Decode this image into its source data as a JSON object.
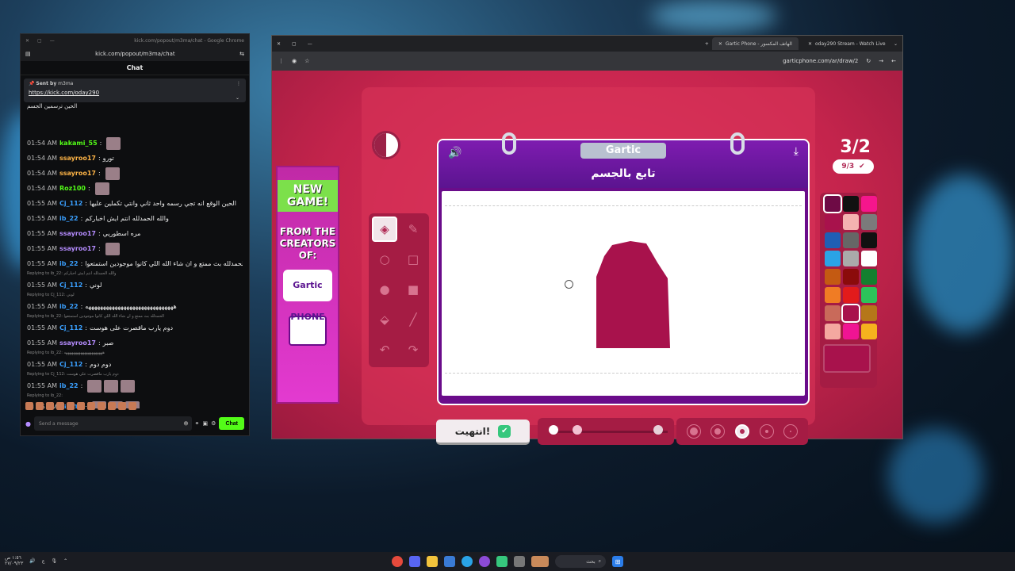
{
  "chat_window": {
    "title_url": "kick.com/popout/m3ma/chat - Google Chrome",
    "address": "kick.com/popout/m3ma/chat",
    "header": "Chat",
    "pinned": {
      "label": "Sent by",
      "user": "m3ma",
      "link": "https://kick.com/oday290"
    },
    "partial_top": "الحين ترسمين الجسم",
    "messages": [
      {
        "time": "01:54 AM",
        "user": "kakami_55",
        "color": "#53fc18",
        "text": "",
        "thumb": true
      },
      {
        "time": "01:54 AM",
        "user": "ssayroo17",
        "color": "#ffb547",
        "text": "تورو",
        "thumb": false
      },
      {
        "time": "01:54 AM",
        "user": "ssayroo17",
        "color": "#ffb547",
        "text": "",
        "thumb": true
      },
      {
        "time": "01:54 AM",
        "user": "Roz100",
        "color": "#53fc18",
        "text": "",
        "thumb": true
      },
      {
        "time": "01:55 AM",
        "user": "Cj_112",
        "color": "#3aa0ff",
        "text": "الحين الوقع انه تجي رسمه واحد ثاني وانتي تكملين عليها",
        "thumb": false
      },
      {
        "time": "01:55 AM",
        "user": "ib_22",
        "color": "#3aa0ff",
        "text": "والله الحمدلله انتم ايش اخباركم",
        "thumb": false
      },
      {
        "time": "01:55 AM",
        "user": "ssayroo17",
        "color": "#b58cff",
        "text": "مره اسطوريي",
        "thumb": false
      },
      {
        "time": "01:55 AM",
        "user": "ssayroo17",
        "color": "#b58cff",
        "text": "",
        "thumb": true
      },
      {
        "time": "01:55 AM",
        "user": "ib_22",
        "color": "#3aa0ff",
        "text": "الحمدلله بث ممتع و ان شاء الله اللي كانوا موجودين استمتعوا",
        "thumb": false
      }
    ],
    "replies": [
      {
        "reply_to": "Replying to ib_22: والله الحمدلله انتم ايش اخباركم",
        "time": "01:55 AM",
        "user": "Cj_112",
        "color": "#3aa0ff",
        "text": "لوني"
      },
      {
        "reply_to": "Replying to Cj_112: لوني",
        "time": "01:55 AM",
        "user": "ib_22",
        "color": "#3aa0ff",
        "text": "ههههههههههههههههههههههههههههههه"
      },
      {
        "reply_to": "Replying to ib_22: الحمدلله بث ممتع و ان شاء الله اللي كانوا موجودين استمتعوا",
        "time": "01:55 AM",
        "user": "Cj_112",
        "color": "#3aa0ff",
        "text": "دوم يارب ماقصرت على هوست"
      },
      {
        "reply_to": "",
        "time": "01:55 AM",
        "user": "ssayroo17",
        "color": "#b58cff",
        "text": "صبر"
      },
      {
        "reply_to": "Replying to ib_22: هههههههههههههههههههههه",
        "time": "01:55 AM",
        "user": "Cj_112",
        "color": "#3aa0ff",
        "text": "دوم دوم"
      },
      {
        "reply_to": "Replying to Cj_112: دوم يارب ماقصرت على هوست",
        "time": "01:55 AM",
        "user": "ib_22",
        "color": "#3aa0ff",
        "text": ""
      },
      {
        "reply_to": "Replying to ib_22:",
        "time": "01:55 AM",
        "user": "Cj_112",
        "color": "#3aa0ff",
        "text": ""
      }
    ],
    "input_placeholder": "Send a message",
    "chat_button": "Chat"
  },
  "game_window": {
    "tabs": [
      "Gartic Phone - الهاتف المكسور",
      "oday290 Stream - Watch Live"
    ],
    "url": "garticphone.com/ar/draw/2",
    "logo": "Gartic",
    "prompt": "تابع بالجسم",
    "round": "3/2",
    "counter": "9/3",
    "done_label": "انتهيت!",
    "ad": {
      "line1": "NEW GAME!",
      "line2": "FROM THE CREATORS OF:",
      "logo": "Gartic PHONE"
    },
    "palette": [
      "#6e0a45",
      "#111111",
      "#f5168c",
      "#a8124c",
      "#f4b3b0",
      "#7b7b7b",
      "#1f5fb4",
      "#666666",
      "#111111",
      "#2aa3e6",
      "#aaaaaa",
      "#ffffff",
      "#c45a12",
      "#8b0b0b",
      "#13802f",
      "#f07c24",
      "#e21b1b",
      "#2cc45a",
      "#c96a5a",
      "#a8124c",
      "#b5771a",
      "#f4a8a0",
      "#f01493",
      "#f6b21e"
    ],
    "drawing_color": "#a8124c",
    "accent": "#c4244c"
  },
  "taskbar": {
    "search": "بحث",
    "lang": "ع",
    "time": "١:٥٦ ص",
    "date": "٢٧/٠٩/٢٣"
  }
}
